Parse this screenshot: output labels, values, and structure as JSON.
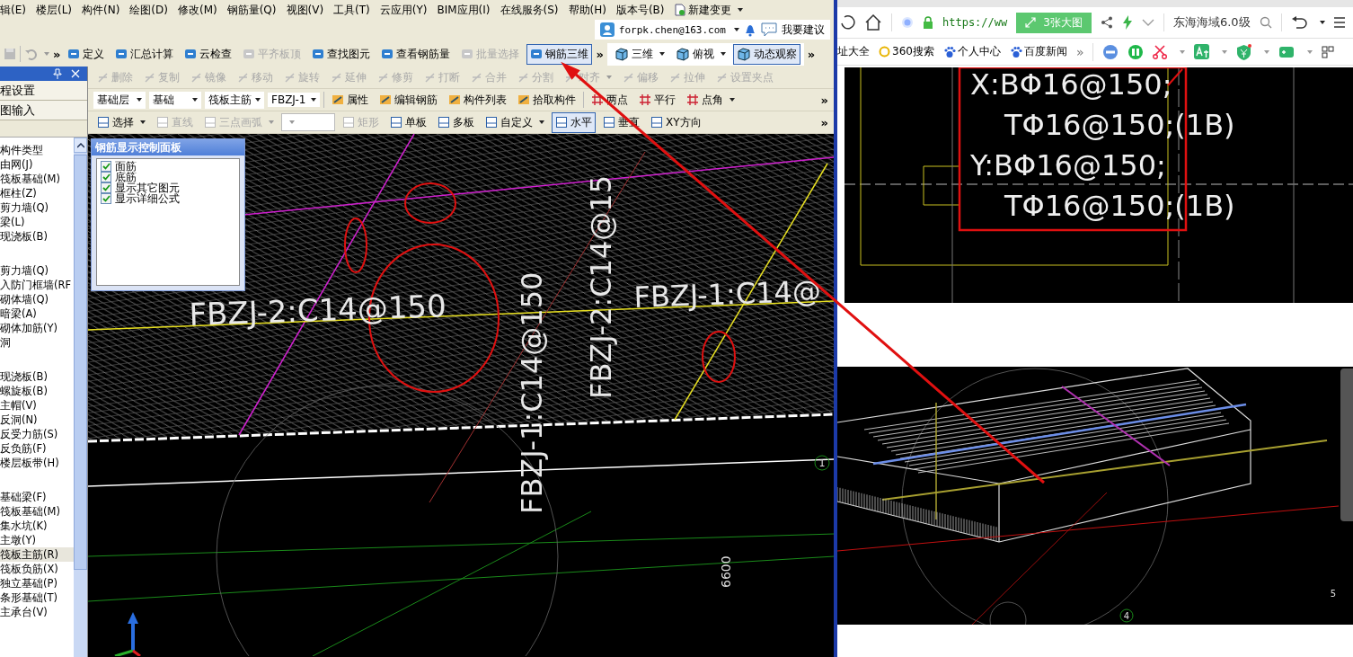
{
  "cad_app": {
    "menu": [
      "辑(E)",
      "楼层(L)",
      "构件(N)",
      "绘图(D)",
      "修改(M)",
      "钢筋量(Q)",
      "视图(V)",
      "工具(T)",
      "云应用(Y)",
      "BIM应用(I)",
      "在线服务(S)",
      "帮助(H)",
      "版本号(B)"
    ],
    "new_change": "新建变更",
    "account": {
      "email": "forpk.chen@163.com",
      "suggest": "我要建议"
    },
    "main_toolbar": {
      "lead_overflow": "»",
      "overflow": "»",
      "items": [
        {
          "label": "定义",
          "disabled": false,
          "selected": false,
          "dropdown": false
        },
        {
          "label": "汇总计算",
          "disabled": false,
          "selected": false,
          "dropdown": false
        },
        {
          "label": "云检查",
          "disabled": false,
          "selected": false,
          "dropdown": false
        },
        {
          "label": "平齐板顶",
          "disabled": true,
          "selected": false,
          "dropdown": false
        },
        {
          "label": "查找图元",
          "disabled": false,
          "selected": false,
          "dropdown": false
        },
        {
          "label": "查看钢筋量",
          "disabled": false,
          "selected": false,
          "dropdown": false
        },
        {
          "label": "批量选择",
          "disabled": true,
          "selected": false,
          "dropdown": false
        },
        {
          "label": "钢筋三维",
          "disabled": false,
          "selected": true,
          "dropdown": false
        }
      ]
    },
    "view_toolbar": {
      "overflow": "»",
      "items": [
        {
          "label": "三维",
          "disabled": false,
          "selected": false,
          "dropdown": true
        },
        {
          "label": "俯视",
          "disabled": false,
          "selected": false,
          "dropdown": true
        },
        {
          "label": "动态观察",
          "disabled": false,
          "selected": true,
          "dropdown": false
        }
      ]
    },
    "side_panel": {
      "sections": [
        "程设置",
        "图输入"
      ],
      "tree": {
        "header": "构件类型",
        "groups": [
          {
            "items": [
              {
                "label": "由网(J)",
                "selected": false
              },
              {
                "label": "筏板基础(M)",
                "selected": false
              },
              {
                "label": "框柱(Z)",
                "selected": false
              },
              {
                "label": "剪力墙(Q)",
                "selected": false
              },
              {
                "label": "梁(L)",
                "selected": false
              },
              {
                "label": "现浇板(B)",
                "selected": false
              }
            ]
          },
          {
            "items": [
              {
                "label": "剪力墙(Q)",
                "selected": false
              },
              {
                "label": "入防门框墙(RF",
                "selected": false
              },
              {
                "label": "砌体墙(Q)",
                "selected": false
              },
              {
                "label": "暗梁(A)",
                "selected": false
              },
              {
                "label": "砌体加筋(Y)",
                "selected": false
              },
              {
                "label": "洞",
                "selected": false
              }
            ]
          },
          {
            "items": [
              {
                "label": "现浇板(B)",
                "selected": false
              },
              {
                "label": "螺旋板(B)",
                "selected": false
              },
              {
                "label": "主帽(V)",
                "selected": false
              },
              {
                "label": "反洞(N)",
                "selected": false
              },
              {
                "label": "反受力筋(S)",
                "selected": false
              },
              {
                "label": "反负筋(F)",
                "selected": false
              },
              {
                "label": "楼层板带(H)",
                "selected": false
              }
            ]
          },
          {
            "items": [
              {
                "label": "基础梁(F)",
                "selected": false
              },
              {
                "label": "筏板基础(M)",
                "selected": false
              },
              {
                "label": "集水坑(K)",
                "selected": false
              },
              {
                "label": "主墩(Y)",
                "selected": false
              },
              {
                "label": "筏板主筋(R)",
                "selected": true
              },
              {
                "label": "筏板负筋(X)",
                "selected": false
              },
              {
                "label": "独立基础(P)",
                "selected": false
              },
              {
                "label": "条形基础(T)",
                "selected": false
              },
              {
                "label": "主承台(V)",
                "selected": false
              }
            ]
          }
        ]
      }
    },
    "edit_toolbar": {
      "items": [
        {
          "label": "删除",
          "disabled": true,
          "dropdown": false
        },
        {
          "label": "复制",
          "disabled": true,
          "dropdown": false
        },
        {
          "label": "镜像",
          "disabled": true,
          "dropdown": false
        },
        {
          "label": "移动",
          "disabled": true,
          "dropdown": false
        },
        {
          "label": "旋转",
          "disabled": true,
          "dropdown": false
        },
        {
          "label": "延伸",
          "disabled": true,
          "dropdown": false
        },
        {
          "label": "修剪",
          "disabled": true,
          "dropdown": false
        },
        {
          "label": "打断",
          "disabled": true,
          "dropdown": false
        },
        {
          "label": "合并",
          "disabled": true,
          "dropdown": false
        },
        {
          "label": "分割",
          "disabled": true,
          "dropdown": false
        },
        {
          "label": "对齐",
          "disabled": true,
          "dropdown": true
        },
        {
          "label": "偏移",
          "disabled": true,
          "dropdown": false
        },
        {
          "label": "拉伸",
          "disabled": true,
          "dropdown": false
        },
        {
          "label": "设置夹点",
          "disabled": true,
          "dropdown": false
        }
      ]
    },
    "selector_bar": {
      "dropdowns": [
        "基础层",
        "基础",
        "筏板主筋",
        "FBZJ-1"
      ],
      "buttons": [
        "属性",
        "编辑钢筋",
        "构件列表",
        "拾取构件"
      ],
      "draw_modes": [
        {
          "label": "两点",
          "dropdown": false
        },
        {
          "label": "平行",
          "dropdown": false
        },
        {
          "label": "点角",
          "dropdown": true
        }
      ],
      "overflow": "»"
    },
    "draw_toolbar": {
      "overflow": "»",
      "items": [
        {
          "label": "选择",
          "disabled": false,
          "selected": false,
          "dropdown": true
        },
        {
          "label": "直线",
          "disabled": true,
          "selected": false,
          "dropdown": false
        },
        {
          "label": "三点画弧",
          "disabled": true,
          "selected": false,
          "dropdown": true
        },
        {
          "label": "矩形",
          "disabled": true,
          "selected": false,
          "dropdown": false
        },
        {
          "label": "单板",
          "disabled": false,
          "selected": false,
          "dropdown": false
        },
        {
          "label": "多板",
          "disabled": false,
          "selected": false,
          "dropdown": false
        },
        {
          "label": "自定义",
          "disabled": false,
          "selected": false,
          "dropdown": true
        },
        {
          "label": "水平",
          "disabled": false,
          "selected": true,
          "dropdown": false
        },
        {
          "label": "垂直",
          "disabled": false,
          "selected": false,
          "dropdown": false
        },
        {
          "label": "XY方向",
          "disabled": false,
          "selected": false,
          "dropdown": false
        }
      ]
    },
    "rebar_panel": {
      "title": "钢筋显示控制面板",
      "options": [
        {
          "label": "面筋",
          "checked": true
        },
        {
          "label": "底筋",
          "checked": true
        },
        {
          "label": "显示其它图元",
          "checked": true
        },
        {
          "label": "显示详细公式",
          "checked": true
        }
      ]
    },
    "canvas": {
      "rebar_labels": [
        "FBZJ-2:C14@150",
        "FBZJ-1:C14@150",
        "FBZJ-2:C14@15",
        "FBZJ-1:C14@"
      ],
      "dimension": "6600",
      "axis_number": "1"
    }
  },
  "browser": {
    "url": "https://ww",
    "image_button": "3张大图",
    "search": "东海海域6.0级",
    "bookmarks": [
      "址大全",
      "360搜索",
      "个人中心",
      "百度新闻"
    ],
    "bookmark_overflow": "»",
    "detail_image": {
      "lines": [
        "X:BΦ16@150;",
        "TΦ16@150;(1B)",
        "Y:BΦ16@150;",
        "TΦ16@150;(1B)"
      ]
    },
    "model_image": {
      "axis_numbers": [
        "4",
        "5"
      ]
    }
  }
}
